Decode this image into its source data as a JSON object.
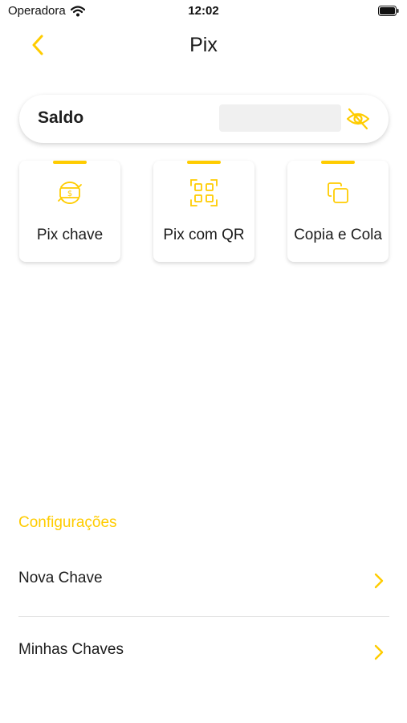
{
  "status_bar": {
    "carrier": "Operadora",
    "time": "12:02"
  },
  "nav": {
    "title": "Pix",
    "back_icon": "chevron-left-icon"
  },
  "balance": {
    "label": "Saldo",
    "value_hidden": true,
    "toggle_icon": "eye-off-icon"
  },
  "actions": [
    {
      "label": "Pix chave",
      "icon": "currency-exchange-icon"
    },
    {
      "label": "Pix com QR",
      "icon": "qr-code-icon"
    },
    {
      "label": "Copia e Cola",
      "icon": "copy-icon"
    }
  ],
  "settings": {
    "header": "Configurações",
    "items": [
      {
        "label": "Nova Chave",
        "icon": "chevron-right-icon"
      },
      {
        "label": "Minhas Chaves",
        "icon": "chevron-right-icon"
      }
    ]
  },
  "colors": {
    "accent": "#ffcc00",
    "text": "#1c1c1c",
    "mask": "#f0f0f0"
  }
}
